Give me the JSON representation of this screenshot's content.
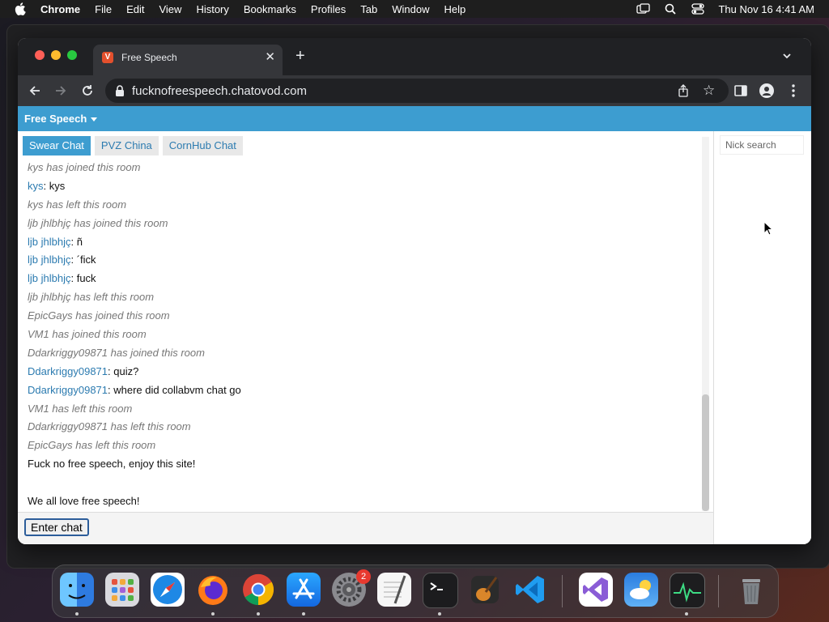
{
  "menubar": {
    "app": "Chrome",
    "items": [
      "File",
      "Edit",
      "View",
      "History",
      "Bookmarks",
      "Profiles",
      "Tab",
      "Window",
      "Help"
    ],
    "clock": "Thu Nov 16  4:41 AM"
  },
  "browser": {
    "tab_title": "Free Speech",
    "favicon_letter": "V",
    "url": "fucknofreespeech.chatovod.com"
  },
  "site": {
    "brand": "Free Speech",
    "room_tabs": [
      "Swear Chat",
      "PVZ China",
      "CornHub Chat"
    ],
    "messages": [
      {
        "text": "kys has joined this room"
      },
      {
        "nick": "kys",
        "text": ": kys"
      },
      {
        "text": "kys has left this room"
      },
      {
        "text": "ljb jhlbhjç has joined this room"
      },
      {
        "nick": "ljb jhlbhjç",
        "text": ": ñ"
      },
      {
        "nick": "ljb jhlbhjç",
        "text": ": ´fick"
      },
      {
        "nick": "ljb jhlbhjç",
        "text": ": fuck"
      },
      {
        "text": "ljb jhlbhjç has left this room"
      },
      {
        "text": "EpicGays has joined this room"
      },
      {
        "text": "VM1 has joined this room"
      },
      {
        "text": "Ddarkriggy09871 has joined this room"
      },
      {
        "nick": "Ddarkriggy09871",
        "text": ": quiz?"
      },
      {
        "nick": "Ddarkriggy09871",
        "text": ": where did collabvm chat go"
      },
      {
        "text": "VM1 has left this room"
      },
      {
        "text": "Ddarkriggy09871 has left this room"
      },
      {
        "text": "EpicGays has left this room"
      },
      {
        "text": "Fuck no free speech, enjoy this site!"
      },
      {
        "text": ""
      },
      {
        "text": "We all love free speech!"
      }
    ],
    "nick_search_placeholder": "Nick search",
    "enter_chat_label": "Enter chat"
  },
  "dock": {
    "settings_badge": "2",
    "icons": [
      "finder-icon",
      "launchpad-icon",
      "safari-icon",
      "firefox-icon",
      "chrome-icon",
      "app-store-icon",
      "system-settings-icon",
      "textedit-icon",
      "terminal-icon",
      "garageband-icon",
      "vscode-icon",
      "visual-studio-icon",
      "weather-icon",
      "activity-monitor-icon",
      "trash-icon"
    ]
  },
  "colors": {
    "site_header": "#3d9dd0",
    "nick_link": "#2c7bb0",
    "system_message": "#777777"
  }
}
